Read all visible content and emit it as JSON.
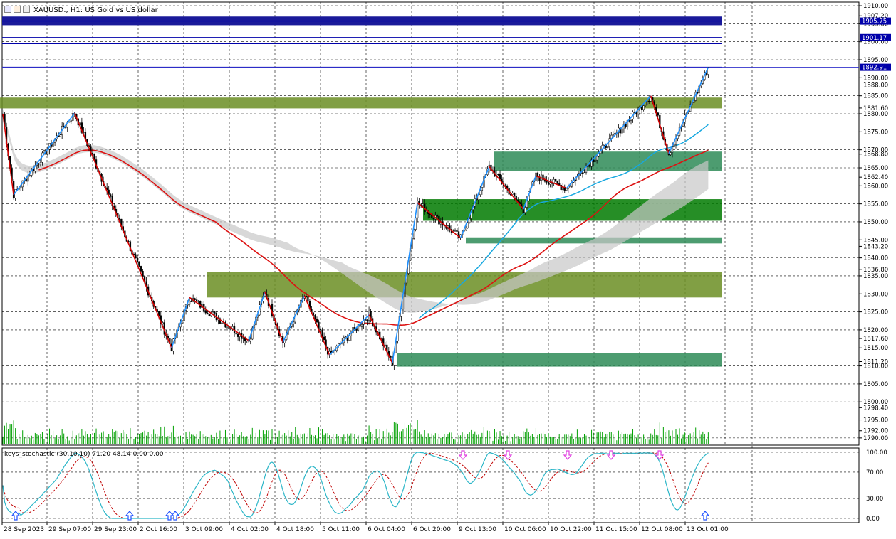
{
  "header": {
    "title": "XAUUSD., H1:  US Gold vs US dollar"
  },
  "indicator": {
    "title": "keys_stochastic (30,10,10) 71.20 48.14 0.00 0.00"
  },
  "colors": {
    "grid": "#000000",
    "candle": "#000000",
    "zigzag_red": "#d40000",
    "zigzag_blue": "#1e90ff",
    "ma_red": "#dd1111",
    "ma_cyan": "#17a8e0",
    "band_gray": "#c8c8c8",
    "zone_olive": "#6b8e23",
    "zone_green": "#2e8b57",
    "zone_darkgreen": "#007a00",
    "line_navy": "#0000aa",
    "stoch_main": "#2bb6c8",
    "stoch_signal": "#c00000",
    "arrow_up": "#1e50ff",
    "arrow_down": "#e040e0",
    "volume": "#00a000"
  },
  "chart_data": [
    {
      "type": "candlestick",
      "symbol": "XAUUSD.",
      "timeframe": "H1",
      "title": "XAUUSD., H1:  US Gold vs US dollar",
      "ylim": [
        1788,
        1911
      ],
      "y_ticks": [
        1910.0,
        1907.2,
        1905.0,
        1900.0,
        1895.0,
        1890.0,
        1888.0,
        1885.0,
        1881.6,
        1880.0,
        1875.0,
        1870.0,
        1868.8,
        1865.0,
        1862.4,
        1860.0,
        1855.0,
        1850.0,
        1845.0,
        1843.2,
        1840.0,
        1836.8,
        1835.0,
        1830.0,
        1825.0,
        1820.0,
        1817.6,
        1815.0,
        1811.2,
        1810.0,
        1805.0,
        1800.0,
        1798.4,
        1795.0,
        1792.0,
        1790.0
      ],
      "x_ticks": [
        "28 Sep 2023",
        "29 Sep 07:00",
        "29 Sep 23:00",
        "2 Oct 16:00",
        "3 Oct 09:00",
        "4 Oct 02:00",
        "4 Oct 18:00",
        "5 Oct 11:00",
        "6 Oct 04:00",
        "6 Oct 20:00",
        "9 Oct 13:00",
        "10 Oct 06:00",
        "10 Oct 22:00",
        "11 Oct 15:00",
        "12 Oct 08:00",
        "13 Oct 01:00"
      ],
      "price_labels": [
        {
          "text": "1905.75",
          "value": 1905.75,
          "color": "#0000aa"
        },
        {
          "text": "1901.17",
          "value": 1901.17,
          "color": "#0000aa"
        },
        {
          "text": "1892.91",
          "value": 1892.91,
          "color": "#0000aa"
        }
      ],
      "horizontal_lines": [
        1905.75,
        1901.17,
        1899.5,
        1892.91
      ],
      "zones": [
        {
          "kind": "olive",
          "x0": 0,
          "x1": 1014,
          "y_hi": 1884.5,
          "y_lo": 1881.5
        },
        {
          "kind": "green",
          "x0": 694,
          "x1": 1014,
          "y_hi": 1869.5,
          "y_lo": 1864.2
        },
        {
          "kind": "darkgreen",
          "x0": 594,
          "x1": 1014,
          "y_hi": 1856.3,
          "y_lo": 1850.3
        },
        {
          "kind": "green",
          "x0": 654,
          "x1": 1014,
          "y_hi": 1845.7,
          "y_lo": 1844.0
        },
        {
          "kind": "olive",
          "x0": 290,
          "x1": 1014,
          "y_hi": 1836.0,
          "y_lo": 1829.0
        },
        {
          "kind": "green",
          "x0": 558,
          "x1": 1014,
          "y_hi": 1813.5,
          "y_lo": 1809.8
        }
      ],
      "zigzag": [
        {
          "i": 0,
          "p": 1880.0
        },
        {
          "i": 6,
          "p": 1857.5
        },
        {
          "i": 40,
          "p": 1880.2
        },
        {
          "i": 94,
          "p": 1815.0
        },
        {
          "i": 104,
          "p": 1829.0
        },
        {
          "i": 137,
          "p": 1817.0
        },
        {
          "i": 146,
          "p": 1830.5
        },
        {
          "i": 156,
          "p": 1816.5
        },
        {
          "i": 168,
          "p": 1829.5
        },
        {
          "i": 182,
          "p": 1813.0
        },
        {
          "i": 204,
          "p": 1824.2
        },
        {
          "i": 217,
          "p": 1810.8
        },
        {
          "i": 231,
          "p": 1855.3
        },
        {
          "i": 255,
          "p": 1845.5
        },
        {
          "i": 271,
          "p": 1865.3
        },
        {
          "i": 290,
          "p": 1853.5
        },
        {
          "i": 297,
          "p": 1862.8
        },
        {
          "i": 314,
          "p": 1859.3
        },
        {
          "i": 361,
          "p": 1885.0
        },
        {
          "i": 371,
          "p": 1869.0
        },
        {
          "i": 393,
          "p": 1892.9
        }
      ],
      "stochastic": {
        "title": "keys_stochastic (30,10,10) 71.20 48.14 0.00 0.00",
        "params": [
          30,
          10,
          10
        ],
        "main_last": 71.2,
        "signal_last": 48.14,
        "ylim": [
          0,
          100
        ],
        "y_ticks": [
          100.0,
          70.0,
          30.0,
          0.0
        ],
        "up_arrow_x": [
          22,
          182,
          238,
          246,
          990
        ],
        "down_arrow_x": [
          650,
          713,
          797,
          858,
          926
        ]
      }
    }
  ]
}
